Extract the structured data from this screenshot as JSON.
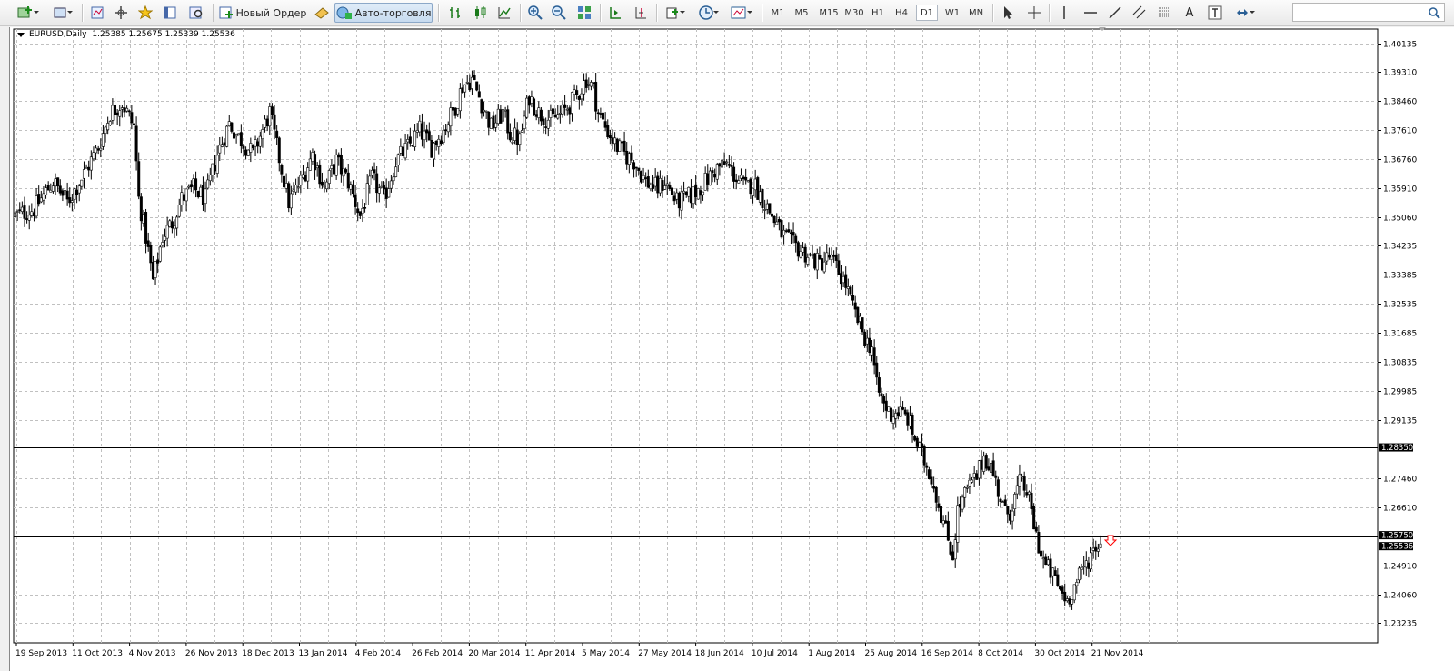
{
  "toolbar": {
    "new_order_label": "Новый Ордер",
    "autotrade_label": "Авто-торговля",
    "timeframes": [
      {
        "label": "M1",
        "active": false
      },
      {
        "label": "M5",
        "active": false
      },
      {
        "label": "M15",
        "active": false
      },
      {
        "label": "M30",
        "active": false
      },
      {
        "label": "H1",
        "active": false
      },
      {
        "label": "H4",
        "active": false
      },
      {
        "label": "D1",
        "active": true
      },
      {
        "label": "W1",
        "active": false
      },
      {
        "label": "MN",
        "active": false
      }
    ],
    "text_tool_label": "A",
    "icons": [
      "new-chart-icon",
      "profiles-icon",
      "market-watch-icon",
      "navigator-icon",
      "favorites-icon",
      "terminal-icon",
      "tester-icon",
      "new-order-icon",
      "meta-editor-icon",
      "autotrade-icon",
      "bar-chart-icon",
      "candlestick-icon",
      "line-chart-icon",
      "zoom-in-icon",
      "zoom-out-icon",
      "tile-windows-icon",
      "autoscroll-icon",
      "chart-shift-icon",
      "indicators-icon",
      "periods-icon",
      "templates-icon",
      "cursor-icon",
      "crosshair-icon",
      "vertical-line-icon",
      "horizontal-line-icon",
      "trendline-icon",
      "equidistant-channel-icon",
      "fibonacci-icon",
      "text-icon",
      "text-label-icon",
      "arrows-icon",
      "search-icon"
    ]
  },
  "chart": {
    "header_symbol": "EURUSD,Daily",
    "header_ohlc": "1.25385 1.25675 1.25339 1.25536",
    "colors": {
      "background": "#ffffff",
      "grid": "#c0c0c0",
      "candle": "#000000",
      "arrow": "#ff0000",
      "label_bg": "#000000",
      "label_text": "#ffffff"
    }
  },
  "chart_data": {
    "type": "candlestick",
    "symbol": "EURUSD",
    "period": "Daily",
    "ylim": [
      1.2265,
      1.4055
    ],
    "y_ticks": [
      "1.40135",
      "1.39310",
      "1.38460",
      "1.37610",
      "1.36760",
      "1.35910",
      "1.35060",
      "1.34235",
      "1.33385",
      "1.32535",
      "1.31685",
      "1.30835",
      "1.29985",
      "1.29135",
      "1.28350",
      "1.27460",
      "1.26610",
      "1.25750",
      "1.25536",
      "1.24910",
      "1.24060",
      "1.23235"
    ],
    "x_ticks": [
      "19 Sep 2013",
      "11 Oct 2013",
      "4 Nov 2013",
      "26 Nov 2013",
      "18 Dec 2013",
      "13 Jan 2014",
      "4 Feb 2014",
      "26 Feb 2014",
      "20 Mar 2014",
      "11 Apr 2014",
      "5 May 2014",
      "27 May 2014",
      "18 Jun 2014",
      "10 Jul 2014",
      "1 Aug 2014",
      "25 Aug 2014",
      "16 Sep 2014",
      "8 Oct 2014",
      "30 Oct 2014",
      "21 Nov 2014"
    ],
    "horizontal_lines": [
      1.2835,
      1.2575
    ],
    "price_labels": [
      {
        "label": "1.28350",
        "value": 1.2835
      },
      {
        "label": "1.25750",
        "value": 1.2575
      },
      {
        "label": "1.25536",
        "value": 1.25536
      }
    ],
    "last_price": 1.25536,
    "close_path": [
      [
        0,
        1.351
      ],
      [
        8,
        1.353
      ],
      [
        16,
        1.361
      ],
      [
        22,
        1.355
      ],
      [
        28,
        1.362
      ],
      [
        35,
        1.371
      ],
      [
        40,
        1.381
      ],
      [
        45,
        1.384
      ],
      [
        50,
        1.377
      ],
      [
        52,
        1.356
      ],
      [
        55,
        1.345
      ],
      [
        58,
        1.332
      ],
      [
        62,
        1.345
      ],
      [
        66,
        1.349
      ],
      [
        70,
        1.356
      ],
      [
        75,
        1.359
      ],
      [
        80,
        1.356
      ],
      [
        85,
        1.369
      ],
      [
        90,
        1.378
      ],
      [
        94,
        1.374
      ],
      [
        100,
        1.369
      ],
      [
        104,
        1.376
      ],
      [
        107,
        1.381
      ],
      [
        110,
        1.371
      ],
      [
        115,
        1.355
      ],
      [
        120,
        1.361
      ],
      [
        125,
        1.369
      ],
      [
        130,
        1.359
      ],
      [
        135,
        1.367
      ],
      [
        140,
        1.361
      ],
      [
        145,
        1.351
      ],
      [
        150,
        1.362
      ],
      [
        155,
        1.356
      ],
      [
        160,
        1.367
      ],
      [
        165,
        1.371
      ],
      [
        170,
        1.376
      ],
      [
        175,
        1.371
      ],
      [
        180,
        1.376
      ],
      [
        185,
        1.383
      ],
      [
        188,
        1.389
      ],
      [
        192,
        1.391
      ],
      [
        196,
        1.384
      ],
      [
        200,
        1.377
      ],
      [
        205,
        1.381
      ],
      [
        208,
        1.375
      ],
      [
        212,
        1.373
      ],
      [
        216,
        1.386
      ],
      [
        220,
        1.381
      ],
      [
        225,
        1.379
      ],
      [
        230,
        1.381
      ],
      [
        236,
        1.386
      ],
      [
        240,
        1.391
      ],
      [
        243,
        1.388
      ],
      [
        245,
        1.381
      ],
      [
        248,
        1.377
      ],
      [
        252,
        1.372
      ],
      [
        256,
        1.369
      ],
      [
        260,
        1.367
      ],
      [
        265,
        1.361
      ],
      [
        270,
        1.359
      ],
      [
        273,
        1.361
      ],
      [
        278,
        1.355
      ],
      [
        282,
        1.356
      ],
      [
        286,
        1.358
      ],
      [
        290,
        1.361
      ],
      [
        295,
        1.365
      ],
      [
        299,
        1.366
      ],
      [
        302,
        1.363
      ],
      [
        307,
        1.359
      ],
      [
        310,
        1.361
      ],
      [
        314,
        1.356
      ],
      [
        318,
        1.351
      ],
      [
        322,
        1.346
      ],
      [
        326,
        1.343
      ],
      [
        330,
        1.341
      ],
      [
        334,
        1.339
      ],
      [
        338,
        1.337
      ],
      [
        342,
        1.339
      ],
      [
        345,
        1.336
      ],
      [
        349,
        1.331
      ],
      [
        352,
        1.324
      ],
      [
        355,
        1.319
      ],
      [
        358,
        1.314
      ],
      [
        360,
        1.313
      ],
      [
        362,
        1.301
      ],
      [
        365,
        1.296
      ],
      [
        368,
        1.293
      ],
      [
        371,
        1.294
      ],
      [
        375,
        1.292
      ],
      [
        378,
        1.286
      ],
      [
        381,
        1.281
      ],
      [
        385,
        1.275
      ],
      [
        388,
        1.267
      ],
      [
        391,
        1.259
      ],
      [
        394,
        1.252
      ],
      [
        396,
        1.265
      ],
      [
        400,
        1.271
      ],
      [
        404,
        1.275
      ],
      [
        407,
        1.281
      ],
      [
        410,
        1.278
      ],
      [
        413,
        1.271
      ],
      [
        416,
        1.264
      ],
      [
        418,
        1.265
      ],
      [
        422,
        1.273
      ],
      [
        425,
        1.271
      ],
      [
        428,
        1.261
      ],
      [
        431,
        1.252
      ],
      [
        433,
        1.249
      ],
      [
        436,
        1.246
      ],
      [
        439,
        1.242
      ],
      [
        442,
        1.239
      ],
      [
        445,
        1.243
      ],
      [
        448,
        1.247
      ],
      [
        451,
        1.251
      ],
      [
        454,
        1.255
      ],
      [
        456,
        1.2554
      ]
    ],
    "n_bars": 457
  }
}
